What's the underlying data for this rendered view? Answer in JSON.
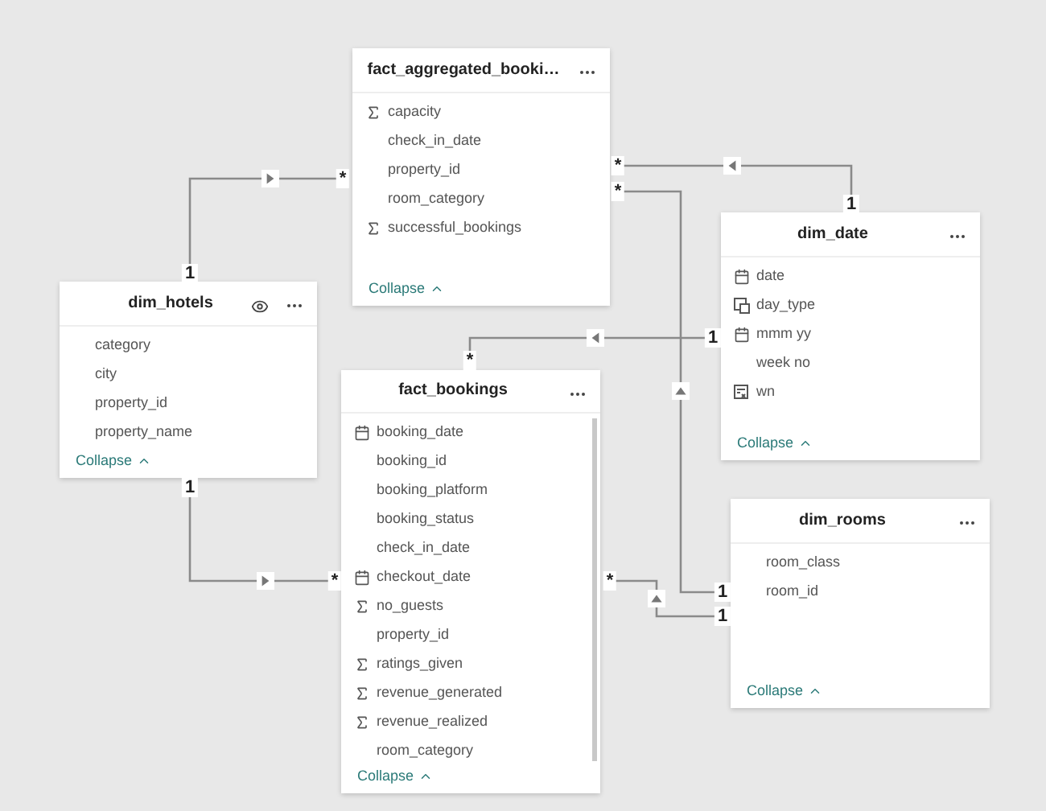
{
  "tables": [
    {
      "name": "fact_aggregated_booki…",
      "visibility_icon": false,
      "fields": [
        {
          "name": "capacity",
          "kind": "measure"
        },
        {
          "name": "check_in_date",
          "kind": "plain"
        },
        {
          "name": "property_id",
          "kind": "plain"
        },
        {
          "name": "room_category",
          "kind": "plain"
        },
        {
          "name": "successful_bookings",
          "kind": "measure"
        }
      ],
      "collapse": "Collapse"
    },
    {
      "name": "dim_hotels",
      "visibility_icon": true,
      "fields": [
        {
          "name": "category",
          "kind": "plain"
        },
        {
          "name": "city",
          "kind": "plain"
        },
        {
          "name": "property_id",
          "kind": "plain"
        },
        {
          "name": "property_name",
          "kind": "plain"
        }
      ],
      "collapse": "Collapse"
    },
    {
      "name": "fact_bookings",
      "visibility_icon": false,
      "fields": [
        {
          "name": "booking_date",
          "kind": "date"
        },
        {
          "name": "booking_id",
          "kind": "plain"
        },
        {
          "name": "booking_platform",
          "kind": "plain"
        },
        {
          "name": "booking_status",
          "kind": "plain"
        },
        {
          "name": "check_in_date",
          "kind": "plain"
        },
        {
          "name": "checkout_date",
          "kind": "date"
        },
        {
          "name": "no_guests",
          "kind": "measure"
        },
        {
          "name": "property_id",
          "kind": "plain"
        },
        {
          "name": "ratings_given",
          "kind": "measure"
        },
        {
          "name": "revenue_generated",
          "kind": "measure"
        },
        {
          "name": "revenue_realized",
          "kind": "measure"
        },
        {
          "name": "room_category",
          "kind": "plain"
        }
      ],
      "collapse": "Collapse"
    },
    {
      "name": "dim_date",
      "visibility_icon": false,
      "fields": [
        {
          "name": "date",
          "kind": "date"
        },
        {
          "name": "day_type",
          "kind": "hierarchy"
        },
        {
          "name": "mmm yy",
          "kind": "date"
        },
        {
          "name": "week no",
          "kind": "plain"
        },
        {
          "name": "wn",
          "kind": "calculated"
        }
      ],
      "collapse": "Collapse"
    },
    {
      "name": "dim_rooms",
      "visibility_icon": false,
      "fields": [
        {
          "name": "room_class",
          "kind": "plain"
        },
        {
          "name": "room_id",
          "kind": "plain"
        }
      ],
      "collapse": "Collapse"
    }
  ],
  "relationships": [
    {
      "one": "1",
      "many": "*"
    },
    {
      "one": "1",
      "many": "*"
    },
    {
      "one": "1",
      "many": "*"
    },
    {
      "one": "1",
      "many": "*"
    },
    {
      "one": "1",
      "many": "*"
    },
    {
      "one": "1",
      "many": "*"
    }
  ]
}
